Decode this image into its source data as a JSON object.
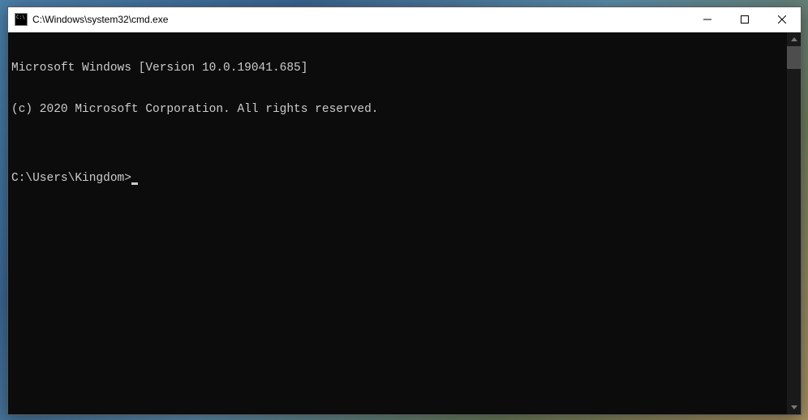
{
  "window": {
    "title": "C:\\Windows\\system32\\cmd.exe"
  },
  "terminal": {
    "line1": "Microsoft Windows [Version 10.0.19041.685]",
    "line2": "(c) 2020 Microsoft Corporation. All rights reserved.",
    "blankline": "",
    "prompt": "C:\\Users\\Kingdom>"
  }
}
